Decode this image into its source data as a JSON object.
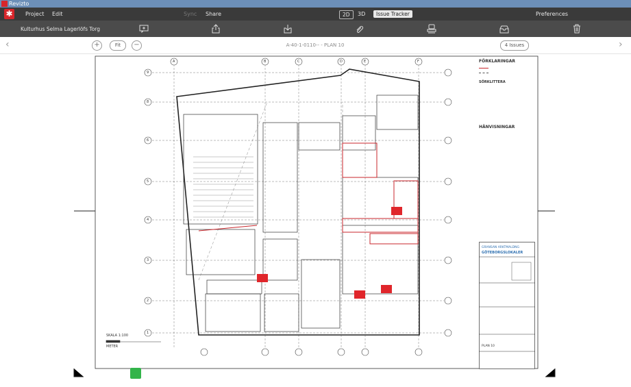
{
  "window": {
    "title": "Revizto"
  },
  "menu": {
    "items": [
      {
        "label": "Project"
      },
      {
        "label": "Edit"
      },
      {
        "label": "Sync"
      },
      {
        "label": "Share"
      }
    ],
    "view_tabs": [
      {
        "label": "2D"
      },
      {
        "label": "3D"
      },
      {
        "label": "Issue Tracker"
      }
    ],
    "preferences": "Preferences"
  },
  "toolbar": {
    "project_name": "Kulturhus Selma Lagerlöfs Torg",
    "buttons": [
      "comment-add-icon",
      "share-up-icon",
      "download-icon",
      "attach-icon",
      "stamp-icon",
      "inbox-icon",
      "trash-icon"
    ]
  },
  "viewbar": {
    "fit_label": "Fit",
    "sheet_name": "A-40-1-0110-- - PLAN 10",
    "issues_label": "4 Issues"
  },
  "drawing": {
    "legend_title": "FÖRKLARINGAR",
    "section_title": "SÖRKLITTERA",
    "references_title": "HÄNVISNINGAR",
    "company": "GRANSAN ARKTMALDNG",
    "client": "GÖTEBORGSLOKALER",
    "plan_label": "PLAN 10",
    "scale_label": "SKALA 1:100",
    "scale_unit": "METER",
    "grid_columns": [
      "A",
      "B",
      "C",
      "D",
      "E",
      "F"
    ],
    "grid_rows": [
      "9",
      "8",
      "7",
      "6",
      "5",
      "4",
      "3",
      "2",
      "1"
    ]
  },
  "colors": {
    "accent": "#d8262b",
    "issue": "#e0262b",
    "status_ok": "#33b44a"
  }
}
